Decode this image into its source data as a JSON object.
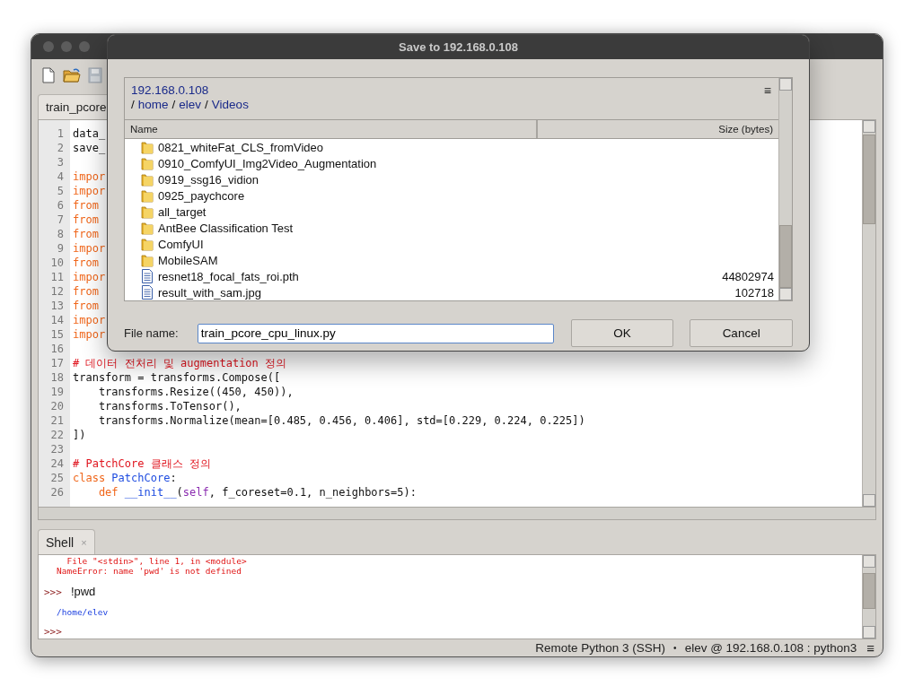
{
  "toolbar": [
    {
      "kind": "new"
    },
    {
      "kind": "open"
    },
    {
      "kind": "save"
    }
  ],
  "editor": {
    "tab": "train_pcore",
    "lines": [
      {
        "number": "1",
        "tokens": [
          {
            "text": "data_",
            "kind": "plain"
          }
        ]
      },
      {
        "number": "2",
        "tokens": [
          {
            "text": "save_",
            "kind": "plain"
          }
        ]
      },
      {
        "number": "3"
      },
      {
        "number": "4",
        "tokens": [
          {
            "text": "impor",
            "kind": "keyword"
          }
        ]
      },
      {
        "number": "5",
        "tokens": [
          {
            "text": "impor",
            "kind": "keyword"
          }
        ]
      },
      {
        "number": "6",
        "tokens": [
          {
            "text": "from",
            "kind": "keyword"
          }
        ]
      },
      {
        "number": "7",
        "tokens": [
          {
            "text": "from",
            "kind": "keyword"
          }
        ]
      },
      {
        "number": "8",
        "tokens": [
          {
            "text": "from",
            "kind": "keyword"
          }
        ]
      },
      {
        "number": "9",
        "tokens": [
          {
            "text": "impor",
            "kind": "keyword"
          }
        ]
      },
      {
        "number": "10",
        "tokens": [
          {
            "text": "from",
            "kind": "keyword"
          }
        ]
      },
      {
        "number": "11",
        "tokens": [
          {
            "text": "impor",
            "kind": "keyword"
          }
        ]
      },
      {
        "number": "12",
        "tokens": [
          {
            "text": "from",
            "kind": "keyword"
          }
        ]
      },
      {
        "number": "13",
        "tokens": [
          {
            "text": "from",
            "kind": "keyword"
          }
        ]
      },
      {
        "number": "14",
        "tokens": [
          {
            "text": "impor",
            "kind": "keyword"
          }
        ]
      },
      {
        "number": "15",
        "tokens": [
          {
            "text": "impor",
            "kind": "keyword"
          }
        ]
      },
      {
        "number": "16"
      },
      {
        "number": "17",
        "tokens": [
          {
            "text": "# 데이터 전처리 및 augmentation 정의",
            "kind": "comment"
          }
        ]
      },
      {
        "number": "18",
        "tokens": [
          {
            "text": "transform = transforms.Compose([",
            "kind": "plain"
          }
        ]
      },
      {
        "number": "19",
        "tokens": [
          {
            "text": "    transforms.Resize((450, 450)),",
            "kind": "plain"
          }
        ]
      },
      {
        "number": "20",
        "tokens": [
          {
            "text": "    transforms.ToTensor(),",
            "kind": "plain"
          }
        ]
      },
      {
        "number": "21",
        "tokens": [
          {
            "text": "    transforms.Normalize(mean=[0.485, 0.456, 0.406], std=[0.229, 0.224, 0.225])",
            "kind": "plain"
          }
        ]
      },
      {
        "number": "22",
        "tokens": [
          {
            "text": "])",
            "kind": "plain"
          }
        ]
      },
      {
        "number": "23"
      },
      {
        "number": "24",
        "tokens": [
          {
            "text": "# PatchCore 클래스 정의",
            "kind": "comment"
          }
        ]
      },
      {
        "number": "25",
        "tokens": [
          {
            "text": "class",
            "kind": "keyword"
          },
          {
            "text": " PatchCore",
            "kind": "name"
          },
          {
            "text": ":",
            "kind": "plain"
          }
        ]
      },
      {
        "number": "26",
        "tokens": [
          {
            "text": "    def",
            "kind": "keyword"
          },
          {
            "text": " __init__",
            "kind": "name"
          },
          {
            "text": "(",
            "kind": "plain"
          },
          {
            "text": "self",
            "kind": "self"
          },
          {
            "text": ", f_coreset=0.1, n_neighbors=5):",
            "kind": "plain"
          }
        ]
      }
    ]
  },
  "shell": {
    "tab": "Shell",
    "close": "×",
    "lines": [
      {
        "kind": "error",
        "text": "  File \"<stdin>\", line 1, in <module>"
      },
      {
        "kind": "error",
        "text": "NameError: name 'pwd' is not defined"
      },
      {
        "kind": "input",
        "prompt": ">>>",
        "text": "!pwd"
      },
      {
        "kind": "output",
        "text": "/home/elev"
      },
      {
        "kind": "input",
        "prompt": ">>>"
      }
    ]
  },
  "status_bar": {
    "interpreter": "Remote Python 3 (SSH)",
    "separator": "•",
    "connection": "elev @ 192.168.0.108 : python3",
    "menu": "≡"
  },
  "dialog": {
    "title": "Save to 192.168.0.108",
    "host": "192.168.0.108",
    "menu": "≡",
    "path": [
      {
        "text": "/",
        "kind": "separator"
      },
      {
        "text": "home",
        "kind": "link"
      },
      {
        "text": "/",
        "kind": "separator"
      },
      {
        "text": "elev",
        "kind": "link"
      },
      {
        "text": "/",
        "kind": "separator"
      },
      {
        "text": "Videos",
        "kind": "link"
      }
    ],
    "columns": [
      "Name",
      "Size (bytes)"
    ],
    "files": [
      {
        "name": "0821_whiteFat_CLS_fromVideo",
        "kind": "folder"
      },
      {
        "name": "0910_ComfyUI_Img2Video_Augmentation",
        "kind": "folder"
      },
      {
        "name": "0919_ssg16_vidion",
        "kind": "folder"
      },
      {
        "name": "0925_paychcore",
        "kind": "folder"
      },
      {
        "name": "all_target",
        "kind": "folder"
      },
      {
        "name": "AntBee Classification Test",
        "kind": "folder"
      },
      {
        "name": "ComfyUI",
        "kind": "folder"
      },
      {
        "name": "MobileSAM",
        "kind": "folder"
      },
      {
        "name": "resnet18_focal_fats_roi.pth",
        "kind": "file",
        "size": "44802974"
      },
      {
        "name": "result_with_sam.jpg",
        "kind": "file",
        "size": "102718"
      }
    ],
    "file_name_label": "File name:",
    "file_name": "train_pcore_cpu_linux.py",
    "buttons": [
      "OK",
      "Cancel"
    ]
  }
}
